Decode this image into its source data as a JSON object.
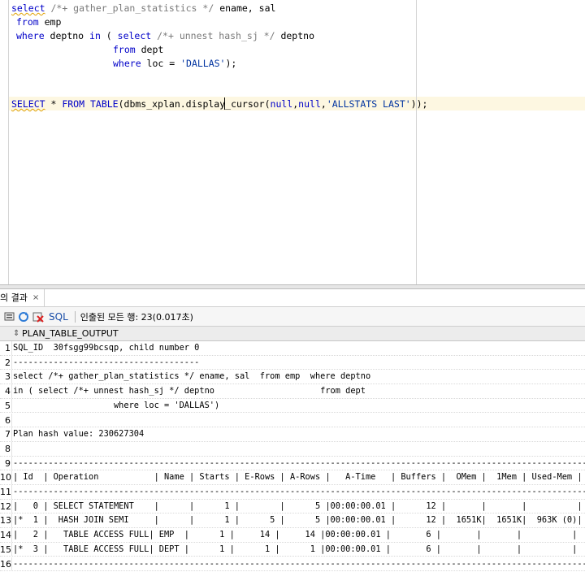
{
  "editor": {
    "line1": {
      "kw_select": "select",
      "comment": " /*+ gather_plan_statistics */",
      "rest": " ename, sal"
    },
    "line2": {
      "kw_from": "from",
      "rest": " emp"
    },
    "line3": {
      "kw_where": "where",
      "mid1": " deptno ",
      "kw_in": "in",
      "mid2": " ( ",
      "kw_select": "select",
      "comment": " /*+ unnest hash_sj */",
      "rest": " deptno"
    },
    "line4": {
      "kw_from": "from",
      "rest": " dept"
    },
    "line5": {
      "kw_where": "where",
      "mid": " loc = ",
      "str": "'DALLAS'",
      "end": ");"
    },
    "line6": {
      "kw_select": "SELECT",
      "star": " * ",
      "kw_from": "FROM",
      "sp": " ",
      "kw_table": "TABLE",
      "fn": "(dbms_xplan.display_cursor(",
      "null1": "null",
      "comma1": ",",
      "null2": "null",
      "comma2": ",",
      "str": "'ALLSTATS LAST'",
      "end": "));"
    }
  },
  "results": {
    "tab_label": "의 결과",
    "tab_close": "×",
    "toolbar": {
      "sql_label": "SQL",
      "status": "인출된 모든 행: 23(0.017초)"
    },
    "column_header": "PLAN_TABLE_OUTPUT",
    "rows": [
      {
        "num": "1",
        "text": "SQL_ID  30fsgg99bcsqp, child number 0"
      },
      {
        "num": "2",
        "text": "-------------------------------------"
      },
      {
        "num": "3",
        "text": "select /*+ gather_plan_statistics */ ename, sal  from emp  where deptno"
      },
      {
        "num": "4",
        "text": "in ( select /*+ unnest hash_sj */ deptno                     from dept"
      },
      {
        "num": "5",
        "text": "                    where loc = 'DALLAS')"
      },
      {
        "num": "6",
        "text": ""
      },
      {
        "num": "7",
        "text": "Plan hash value: 230627304"
      },
      {
        "num": "8",
        "text": ""
      },
      {
        "num": "9",
        "text": "-------------------------------------------------------------------------------------------------------------------"
      },
      {
        "num": "10",
        "text": "| Id  | Operation           | Name | Starts | E-Rows | A-Rows |   A-Time   | Buffers |  OMem |  1Mem | Used-Mem |"
      },
      {
        "num": "11",
        "text": "-------------------------------------------------------------------------------------------------------------------"
      },
      {
        "num": "12",
        "text": "|   0 | SELECT STATEMENT    |      |      1 |        |      5 |00:00:00.01 |      12 |       |       |          |"
      },
      {
        "num": "13",
        "text": "|*  1 |  HASH JOIN SEMI     |      |      1 |      5 |      5 |00:00:00.01 |      12 |  1651K|  1651K|  963K (0)|"
      },
      {
        "num": "14",
        "text": "|   2 |   TABLE ACCESS FULL| EMP  |      1 |     14 |     14 |00:00:00.01 |       6 |       |       |          |"
      },
      {
        "num": "15",
        "text": "|*  3 |   TABLE ACCESS FULL| DEPT |      1 |      1 |      1 |00:00:00.01 |       6 |       |       |          |"
      },
      {
        "num": "16",
        "text": "-------------------------------------------------------------------------------------------------------------------"
      }
    ]
  }
}
